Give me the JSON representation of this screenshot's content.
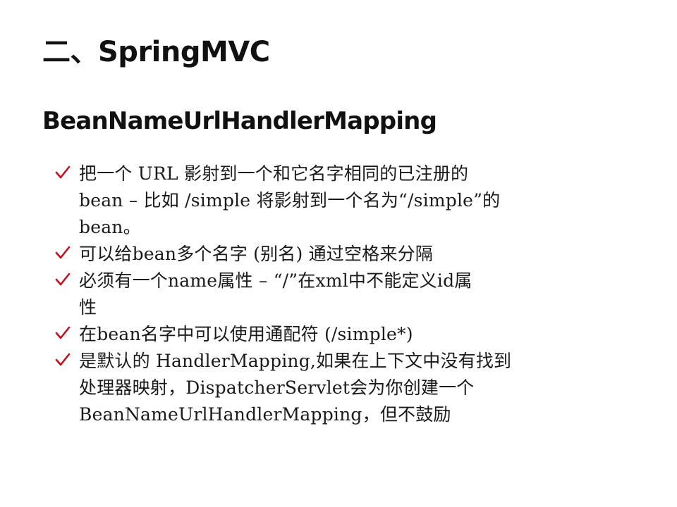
{
  "slide": {
    "title": "二、SpringMVC",
    "subtitle": "BeanNameUrlHandlerMapping",
    "accent_color": "#c0121e",
    "bullets": [
      {
        "lines": [
          "把一个 URL 影射到一个和它名字相同的已注册的",
          "bean – 比如 /simple 将影射到一个名为“/simple”的",
          "bean。"
        ]
      },
      {
        "lines": [
          "可以给bean多个名字 (别名) 通过空格来分隔"
        ]
      },
      {
        "lines": [
          "必须有一个name属性 – “/”在xml中不能定义id属",
          "性"
        ]
      },
      {
        "lines": [
          "在bean名字中可以使用通配符 (/simple*)"
        ]
      },
      {
        "lines": [
          "是默认的 HandlerMapping,如果在上下文中没有找到",
          "处理器映射，DispatcherServlet会为你创建一个",
          "BeanNameUrlHandlerMapping，但不鼓励"
        ]
      }
    ]
  }
}
